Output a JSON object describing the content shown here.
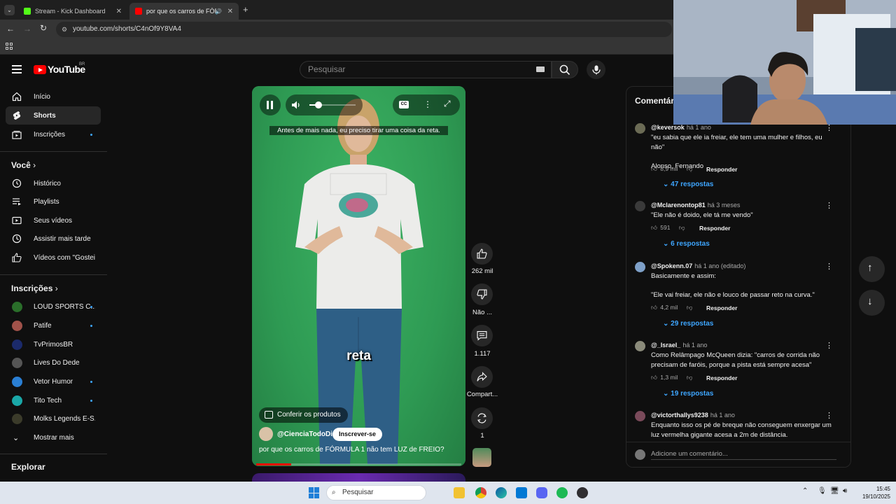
{
  "browser": {
    "tabs": [
      {
        "title": "Stream - Kick Dashboard",
        "favicon_color": "#53fc18"
      },
      {
        "title": "por que os carros de FÓRMU",
        "favicon_color": "#ff0000"
      }
    ],
    "url": "youtube.com/shorts/C4nOf9Y8VA4"
  },
  "header": {
    "logo_text": "YouTube",
    "region": "BR",
    "search_placeholder": "Pesquisar"
  },
  "sidebar": {
    "main": [
      {
        "label": "Início",
        "icon": "home-icon"
      },
      {
        "label": "Shorts",
        "icon": "shorts-icon"
      },
      {
        "label": "Inscrições",
        "icon": "subscriptions-icon"
      }
    ],
    "you_title": "Você",
    "you": [
      {
        "label": "Histórico",
        "icon": "history-icon"
      },
      {
        "label": "Playlists",
        "icon": "playlists-icon"
      },
      {
        "label": "Seus vídeos",
        "icon": "your-videos-icon"
      },
      {
        "label": "Assistir mais tarde",
        "icon": "watch-later-icon"
      },
      {
        "label": "Vídeos com \"Gostei\"",
        "icon": "like-icon"
      }
    ],
    "subs_title": "Inscrições",
    "subs": [
      {
        "label": "LOUD SPORTS C...",
        "color": "#2a6e2a"
      },
      {
        "label": "Patife",
        "color": "#a0524a"
      },
      {
        "label": "TvPrimosBR",
        "color": "#1b2a6b"
      },
      {
        "label": "Lives Do Dede",
        "color": "#555555"
      },
      {
        "label": "Vetor Humor",
        "color": "#2a7fd4"
      },
      {
        "label": "Tito Tech",
        "color": "#1aa7a7"
      },
      {
        "label": "Molks Legends E-S...",
        "color": "#3b3b2a"
      }
    ],
    "show_more": "Mostrar mais",
    "explore_title": "Explorar"
  },
  "video": {
    "subtitle": "Antes de mais nada, eu preciso tirar uma coisa da reta.",
    "caption_word": "reta",
    "products_label": "Conferir os produtos",
    "channel": "@CienciaTodoDia",
    "subscribe_label": "Inscrever-se",
    "title": "por que os carros de FÓRMULA 1 não tem LUZ de FREIO?",
    "progress": 0.17
  },
  "actions": {
    "likes": "262 mil",
    "dislike": "Não ...",
    "comments": "1.117",
    "share": "Compart...",
    "remix": "1"
  },
  "comments": {
    "title": "Comentár",
    "items": [
      {
        "author": "@keversok",
        "time": "há 1 ano",
        "text": "\"eu sabia que ele ia freiar, ele tem uma mulher e filhos, eu não\"\n\nAlonso, Fernando",
        "likes": "8,9 mil",
        "reply": "Responder",
        "replies": "47 respostas",
        "color": "#6b6b55"
      },
      {
        "author": "@Mclarenontop81",
        "time": "há 3 meses",
        "text": "\"Ele não é doido, ele tá me vendo\"",
        "likes": "591",
        "reply": "Responder",
        "replies": "6 respostas",
        "color": "#3a3a3a"
      },
      {
        "author": "@Spokenn.07",
        "time": "há 1 ano (editado)",
        "text": "Basicamente e assim:\n\n\"Ele vai freiar, ele não e louco de passar reto na curva.\"",
        "likes": "4,2 mil",
        "reply": "Responder",
        "replies": "29 respostas",
        "color": "#7ea0c8"
      },
      {
        "author": "@_Israel_",
        "time": "há 1 ano",
        "text": "Como Relâmpago McQueen dizia: \"carros de corrida não precisam de faróis, porque a pista está sempre acesa\"",
        "likes": "1,3 mil",
        "reply": "Responder",
        "replies": "19 respostas",
        "color": "#8a8a7a"
      },
      {
        "author": "@victorthallys9238",
        "time": "há 1 ano",
        "text": "Enquanto isso os pé de breque não conseguem enxergar um luz vermelha gigante acesa a 2m de distância.",
        "likes": "",
        "reply": "",
        "replies": "",
        "color": "#7a4a5a"
      }
    ],
    "add_placeholder": "Adicione um comentário..."
  },
  "taskbar": {
    "search": "Pesquisar",
    "time": "15:45",
    "date": "19/10/2025"
  }
}
